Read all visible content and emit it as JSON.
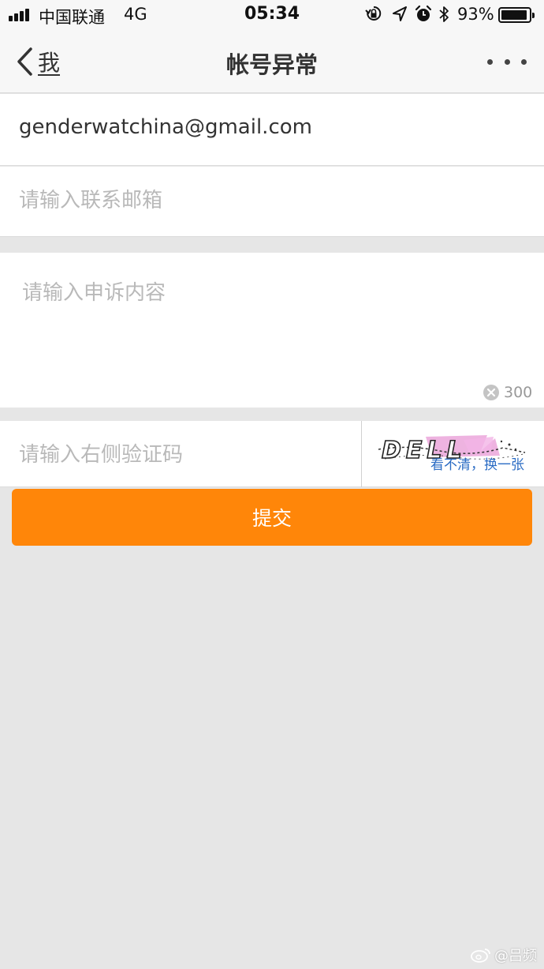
{
  "status_bar": {
    "carrier": "中国联通",
    "network": "4G",
    "time": "05:34",
    "battery_percent": "93%",
    "battery_level": 0.93,
    "icons": [
      "signal-icon",
      "rotation-lock-icon",
      "location-icon",
      "alarm-icon",
      "bluetooth-icon",
      "battery-icon"
    ]
  },
  "nav": {
    "back_label": "我",
    "title": "帐号异常",
    "more_icon": "more-dots-icon"
  },
  "form": {
    "email_value": "genderwatchina@gmail.com",
    "contact_placeholder": "请输入联系邮箱",
    "content_placeholder": "请输入申诉内容",
    "char_limit": "300",
    "captcha_placeholder": "请输入右侧验证码",
    "captcha_text": "DELL",
    "captcha_refresh": "看不清，换一张",
    "submit_label": "提交"
  },
  "colors": {
    "accent": "#ff8609",
    "link": "#2b6cc4",
    "background": "#e6e6e6"
  },
  "watermark": {
    "icon": "weibo-icon",
    "text": "@吕频"
  }
}
